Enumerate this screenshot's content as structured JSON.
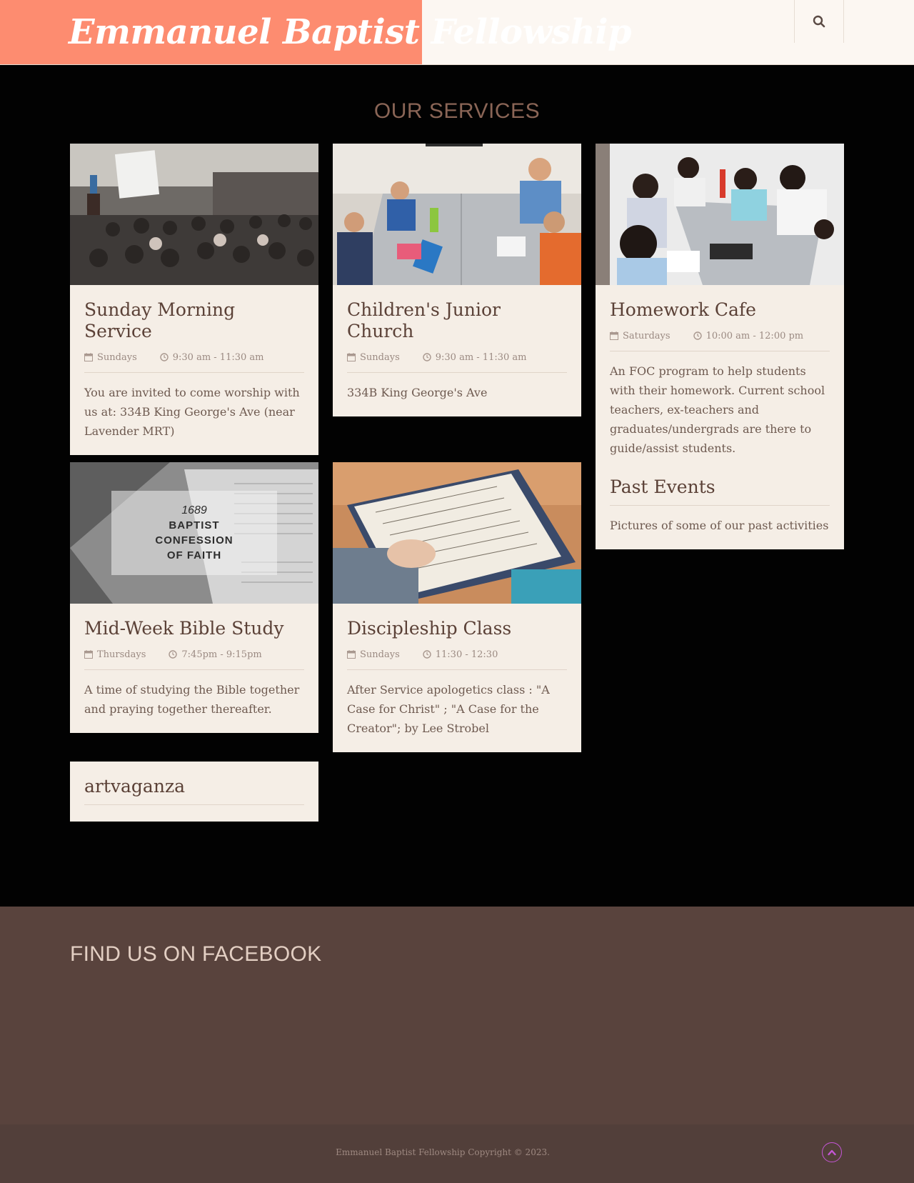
{
  "site": {
    "title": "Emmanuel Baptist Fellowship"
  },
  "header": {
    "search_icon": "search-icon"
  },
  "services": {
    "title": "OUR SERVICES",
    "cards": [
      {
        "title": "Sunday Morning Service",
        "day": "Sundays",
        "time": "9:30 am - 11:30 am",
        "description": "You are invited to come worship with us at: 334B King George's Ave (near Lavender MRT)"
      },
      {
        "title": "Children's Junior Church",
        "day": "Sundays",
        "time": "9:30 am - 11:30 am",
        "description": "334B King George's Ave"
      },
      {
        "title": "Homework Cafe",
        "day": "Saturdays",
        "time": "10:00 am - 12:00 pm",
        "description": "An FOC program to help students with their homework. Current school teachers, ex-teachers and graduates/undergrads are there to guide/assist students."
      },
      {
        "title": "Mid-Week Bible Study",
        "day": "Thursdays",
        "time": "7:45pm - 9:15pm",
        "description": "A time of studying the Bible together and praying together thereafter."
      },
      {
        "title": "Discipleship Class",
        "day": "Sundays",
        "time": "11:30 - 12:30",
        "description": "After Service apologetics class : \"A Case for Christ\" ; \"A Case for the Creator\"; by Lee Strobel"
      },
      {
        "title": "Past Events",
        "description": "Pictures of some of our past activities"
      },
      {
        "title": "artvaganza"
      }
    ],
    "confession_image": {
      "year": "1689",
      "line1": "BAPTIST",
      "line2": "CONFESSION",
      "line3": "OF FAITH"
    }
  },
  "facebook": {
    "title": "FIND US ON FACEBOOK"
  },
  "footer": {
    "copyright": "Emmanuel Baptist Fellowship Copyright © 2023."
  },
  "colors": {
    "accent": "#fd8c70",
    "header_bg": "#fcf7f2",
    "card_bg": "#f5eee6",
    "footer_bg": "#59433d",
    "totop": "#c556d6"
  }
}
